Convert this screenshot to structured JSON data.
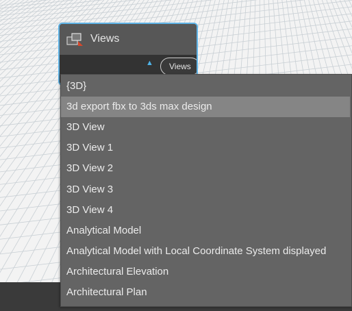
{
  "node": {
    "title": "Views",
    "output_label": "Views",
    "caret_icon": "chevron-up-icon",
    "node_icon": "views-node-icon"
  },
  "dropdown": {
    "highlighted_index": 1,
    "items": [
      "{3D}",
      "3d export fbx to 3ds max design",
      "3D View",
      "3D View 1",
      "3D View 2",
      "3D View 3",
      "3D View 4",
      "Analytical Model",
      "Analytical Model with Local Coordinate System displayed",
      "Architectural Elevation",
      "Architectural Plan"
    ]
  },
  "colors": {
    "selection_border": "#5eb3e6",
    "menu_background": "#646464",
    "menu_highlight": "#858585",
    "caret": "#4fb3e8"
  }
}
